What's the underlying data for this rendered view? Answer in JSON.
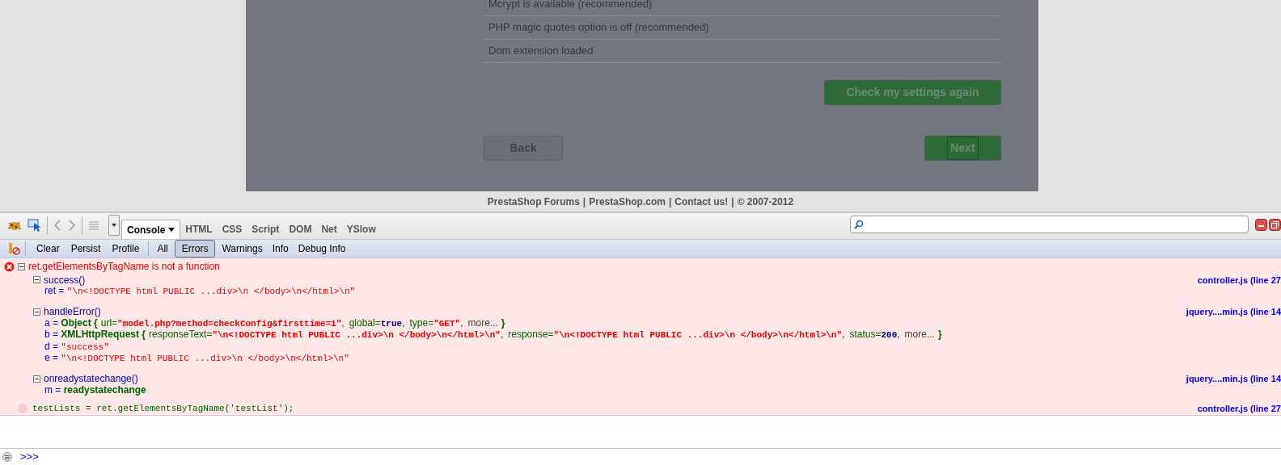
{
  "page": {
    "checklist": [
      "Mcrypt is available (recommended)",
      "PHP magic quotes option is off (recommended)",
      "Dom extension loaded"
    ],
    "check_button": "Check my settings again",
    "back_button": "Back",
    "next_button": "Next",
    "footer": {
      "links": [
        "PrestaShop Forums",
        "PrestaShop.com",
        "Contact us!",
        "© 2007-2012"
      ],
      "separator": "|"
    }
  },
  "firebug": {
    "panel_tabs": [
      {
        "label": "Console",
        "selected": true
      },
      {
        "label": "HTML",
        "selected": false
      },
      {
        "label": "CSS",
        "selected": false
      },
      {
        "label": "Script",
        "selected": false
      },
      {
        "label": "DOM",
        "selected": false
      },
      {
        "label": "Net",
        "selected": false
      },
      {
        "label": "YSlow",
        "selected": false
      }
    ],
    "console_buttons": [
      "Clear",
      "Persist",
      "Profile"
    ],
    "filters": [
      {
        "label": "All",
        "selected": false
      },
      {
        "label": "Errors",
        "selected": true
      },
      {
        "label": "Warnings",
        "selected": false
      },
      {
        "label": "Info",
        "selected": false
      },
      {
        "label": "Debug Info",
        "selected": false
      }
    ],
    "error": {
      "message": "ret.getElementsByTagName is not a function",
      "expanded": true,
      "frames": [
        {
          "name": "success()",
          "expanded": true,
          "source": "controller.js (line 27",
          "vars": [
            [
              {
                "kind": "var",
                "text": "ret = "
              },
              {
                "kind": "str",
                "text": "\"\\n<!DOCTYPE html PUBLIC ...div>\\n </body>\\n</html>\\n\""
              }
            ]
          ]
        },
        {
          "name": "handleError()",
          "expanded": true,
          "source": "jquery....min.js (line 14",
          "vars": [
            [
              {
                "kind": "var",
                "text": "a = "
              },
              {
                "kind": "obj",
                "text": "Object {"
              },
              {
                "kind": "prop",
                "text": "url="
              },
              {
                "kind": "strb",
                "text": "\"model.php?method=checkConfig&firsttime=1\""
              },
              {
                "kind": "sep",
                "text": ","
              },
              {
                "kind": "prop",
                "text": "global="
              },
              {
                "kind": "lit",
                "text": "true"
              },
              {
                "kind": "sep",
                "text": ","
              },
              {
                "kind": "prop",
                "text": "type="
              },
              {
                "kind": "strb",
                "text": "\"GET\""
              },
              {
                "kind": "sep",
                "text": ","
              },
              {
                "kind": "more",
                "text": "more..."
              },
              {
                "kind": "obj",
                "text": "}"
              }
            ],
            [
              {
                "kind": "var",
                "text": "b = "
              },
              {
                "kind": "obj",
                "text": "XMLHttpRequest {"
              },
              {
                "kind": "prop",
                "text": "responseText="
              },
              {
                "kind": "strb",
                "text": "\"\\n<!DOCTYPE html PUBLIC ...div>\\n </body>\\n</html>\\n\""
              },
              {
                "kind": "sep",
                "text": ","
              },
              {
                "kind": "prop",
                "text": "response="
              },
              {
                "kind": "strb",
                "text": "\"\\n<!DOCTYPE html PUBLIC ...div>\\n </body>\\n</html>\\n\""
              },
              {
                "kind": "sep",
                "text": ","
              },
              {
                "kind": "prop",
                "text": "status="
              },
              {
                "kind": "lit",
                "text": "200"
              },
              {
                "kind": "sep",
                "text": ","
              },
              {
                "kind": "more",
                "text": "more..."
              },
              {
                "kind": "obj",
                "text": "}"
              }
            ],
            [
              {
                "kind": "var",
                "text": "d = "
              },
              {
                "kind": "str",
                "text": "\"success\""
              }
            ],
            [
              {
                "kind": "var",
                "text": "e = "
              },
              {
                "kind": "str",
                "text": "\"\\n<!DOCTYPE html PUBLIC ...div>\\n </body>\\n</html>\\n\""
              }
            ]
          ]
        },
        {
          "name": "onreadystatechange()",
          "expanded": true,
          "source": "jquery....min.js (line 14",
          "vars": [
            [
              {
                "kind": "var",
                "text": "m = "
              },
              {
                "kind": "obj",
                "text": "readystatechange"
              }
            ]
          ]
        }
      ],
      "code_line": "testLists = ret.getElementsByTagName('testList');",
      "code_source": "controller.js (line 27"
    },
    "prompt": ">>>"
  }
}
